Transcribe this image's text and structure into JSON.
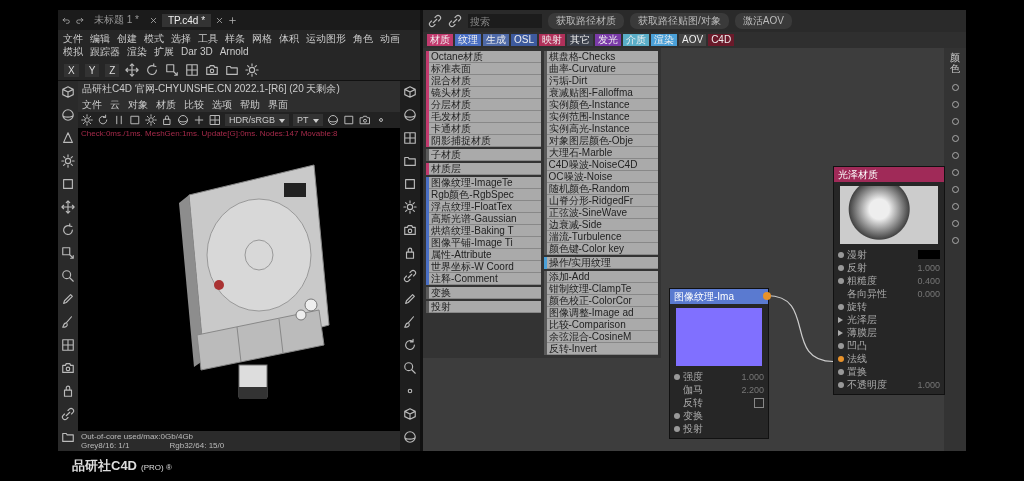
{
  "c4d": {
    "tabs": [
      {
        "label": "未标题 1 *",
        "selected": false
      },
      {
        "label": "TP.c4d *",
        "selected": true
      }
    ],
    "menu": [
      "文件",
      "编辑",
      "创建",
      "模式",
      "选择",
      "工具",
      "样条",
      "网格",
      "体积",
      "运动图形",
      "角色",
      "动画",
      "模拟",
      "跟踪器",
      "渲染",
      "扩展",
      "Dar 3D",
      "Arnold"
    ],
    "axis_buttons": [
      {
        "label": "X",
        "selected": false
      },
      {
        "label": "Y",
        "selected": false
      },
      {
        "label": "Z",
        "selected": false
      }
    ],
    "viewer": {
      "title": "品研社C4D 官网-CHYUNSHE.CN 2022.1-[R6] (20 天剩余)",
      "menu": [
        "文件",
        "云",
        "对象",
        "材质",
        "比较",
        "选项",
        "帮助",
        "界面"
      ],
      "color_mode": "HDR/sRGB",
      "kernel": "PT",
      "status": "Check:0ms./1ms. MeshGen:1ms. Update[G]:0ms. Nodes:147 Movable:8",
      "stats": [
        "Out-of-core used/max:0Gb/4Gb",
        "Grey8/16: 1/1",
        "Rgb32/64: 15/0"
      ]
    }
  },
  "node_editor": {
    "search": {
      "placeholder": "搜索"
    },
    "buttons": [
      "获取路径材质",
      "获取路径贴图/对象",
      "激活AOV"
    ],
    "categories": [
      {
        "label": "材质",
        "color": "#c23a6e"
      },
      {
        "label": "纹理",
        "color": "#4a6fc4"
      },
      {
        "label": "生成",
        "color": "#4f6aa8"
      },
      {
        "label": "OSL",
        "color": "#3d5a9e"
      },
      {
        "label": "映射",
        "color": "#b0305a"
      },
      {
        "label": "其它",
        "color": "#3a3f4a"
      },
      {
        "label": "发光",
        "color": "#7a3aa8"
      },
      {
        "label": "介质",
        "color": "#5aaec8"
      },
      {
        "label": "渲染",
        "color": "#4aa0d8"
      },
      {
        "label": "AOV",
        "color": "#444444"
      },
      {
        "label": "C4D",
        "color": "#6a1a2a"
      }
    ],
    "node_groups": [
      {
        "color": "#c23a6e",
        "items": [
          "Octane材质",
          "标准表面",
          "混合材质",
          "镜头材质",
          "分层材质",
          "毛发材质",
          "卡通材质",
          "阴影捕捉材质"
        ]
      },
      {
        "color": "#5a5a5a",
        "items": [
          "子材质"
        ]
      },
      {
        "color": "#c23a6e",
        "items": [
          "材质层"
        ]
      },
      {
        "color": "#4a6fc4",
        "items": [
          "图像纹理-ImageTe",
          "Rgb颜色-RgbSpec",
          "浮点纹理-FloatTex",
          "高斯光谱-Gaussian",
          "烘焙纹理-Baking T",
          "图像平铺-Image Ti",
          "属性-Attribute",
          "世界坐标-W Coord",
          "注释-Comment"
        ]
      },
      {
        "color": "#5a5a5a",
        "items": [
          "变换"
        ]
      },
      {
        "color": "#5a5a5a",
        "items": [
          "投射"
        ]
      },
      {
        "color": "#5a5a5a",
        "items": [
          "棋盘格-Checks",
          "曲率-Curvature",
          "污垢-Dirt",
          "衰减贴图-Falloffma",
          "实例颜色-Instance",
          "实例范围-Instance",
          "实例高光-Instance",
          "对象图层颜色-Obje",
          "大理石-Marble",
          "C4D噪波-NoiseC4D",
          "OC噪波-Noise",
          "随机颜色-Random",
          "山脊分形-RidgedFr",
          "正弦波-SineWave",
          "边衰减-Side",
          "湍流-Turbulence",
          "颜色键-Color key"
        ]
      },
      {
        "color": "#4aa0d8",
        "items": [
          "操作/实用纹理"
        ]
      },
      {
        "color": "#5a5a5a",
        "items": [
          "添加-Add",
          "钳制纹理-ClampTe",
          "颜色校正-ColorCor",
          "图像调整-Image ad",
          "比较-Comparison",
          "余弦混合-CosineM",
          "反转-Invert"
        ]
      }
    ],
    "nodes": [
      {
        "kind": "texture",
        "title": "图像纹理-Ima",
        "color": "#5a7ad0",
        "ports": [
          {
            "kind": "dot",
            "label": "强度",
            "value": "1.000",
            "connected": false
          },
          {
            "kind": "value",
            "label": "伽马",
            "value": "2.200"
          },
          {
            "kind": "checkbox",
            "label": "反转",
            "checked": false
          },
          {
            "kind": "dot",
            "label": "变换",
            "connected": false
          },
          {
            "kind": "dot",
            "label": "投射",
            "connected": false
          }
        ]
      },
      {
        "kind": "material",
        "title": "光泽材质",
        "color": "#a02a58",
        "ports": [
          {
            "kind": "swatch",
            "label": "漫射",
            "connected": false
          },
          {
            "kind": "dot",
            "label": "反射",
            "value": "1.000",
            "connected": false
          },
          {
            "kind": "dot",
            "label": "粗糙度",
            "value": "0.400",
            "connected": false
          },
          {
            "kind": "value",
            "label": "各向异性",
            "value": "0.000"
          },
          {
            "kind": "dot",
            "label": "旋转",
            "connected": false
          },
          {
            "kind": "fold",
            "label": "光泽层"
          },
          {
            "kind": "fold",
            "label": "薄膜层"
          },
          {
            "kind": "dot",
            "label": "凹凸",
            "connected": false
          },
          {
            "kind": "dot",
            "label": "法线",
            "connected": true
          },
          {
            "kind": "dot",
            "label": "置换",
            "connected": false
          },
          {
            "kind": "dot",
            "label": "不透明度",
            "value": "1.000",
            "connected": false
          }
        ]
      }
    ],
    "side_panel": {
      "label": "颜色"
    }
  },
  "footer": {
    "brand": "品研社C4D",
    "edition": "(PRO) ®"
  }
}
